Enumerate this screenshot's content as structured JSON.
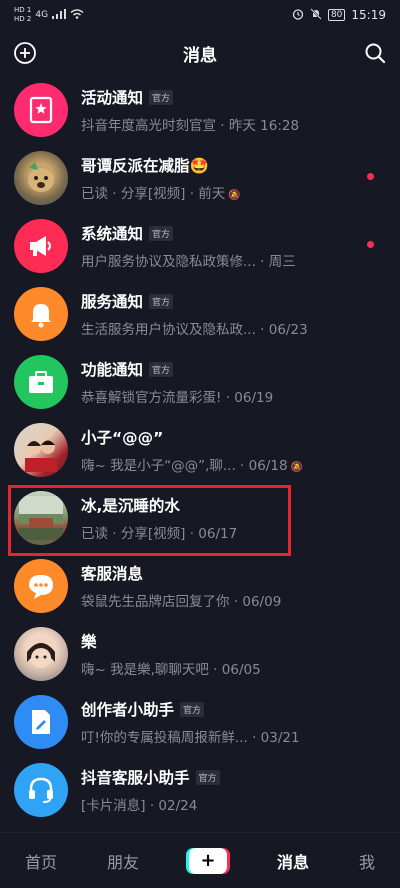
{
  "status": {
    "hd1": "HD 1",
    "hd2": "HD 2",
    "net": "4G",
    "battery": "80",
    "time": "15:19"
  },
  "header": {
    "title": "消息"
  },
  "conversations": [
    {
      "name": "活动通知",
      "badge": "官方",
      "preview": "抖音年度高光时刻官宣 · 昨天 16:28"
    },
    {
      "name": "哥谭反派在减脂🤩",
      "badge": "",
      "preview": "已读 · 分享[视频] · 前天"
    },
    {
      "name": "系统通知",
      "badge": "官方",
      "preview": "用户服务协议及隐私政策修...  · 周三"
    },
    {
      "name": "服务通知",
      "badge": "官方",
      "preview": "生活服务用户协议及隐私政... · 06/23"
    },
    {
      "name": "功能通知",
      "badge": "官方",
      "preview": "恭喜解锁官方流量彩蛋!  · 06/19"
    },
    {
      "name": "小子“@@”",
      "badge": "",
      "preview": "嗨~ 我是小子“@@”,聊...  · 06/18"
    },
    {
      "name": "冰,是沉睡的水",
      "badge": "",
      "preview": "已读 · 分享[视频] · 06/17"
    },
    {
      "name": "客服消息",
      "badge": "",
      "preview": "袋鼠先生品牌店回复了你 · 06/09"
    },
    {
      "name": "樂",
      "badge": "",
      "preview": "嗨~ 我是樂,聊聊天吧 · 06/05"
    },
    {
      "name": "创作者小助手",
      "badge": "官方",
      "preview": "叮!你的专属投稿周报新鲜... · 03/21"
    },
    {
      "name": "抖音客服小助手",
      "badge": "官方",
      "preview": "[卡片消息] · 02/24"
    }
  ],
  "bottom_nav": {
    "home": "首页",
    "friends": "朋友",
    "plus": "+",
    "messages": "消息",
    "me": "我"
  },
  "colors": {
    "background": "#161823",
    "unread": "#fe2c55",
    "highlight": "#e5272d"
  }
}
